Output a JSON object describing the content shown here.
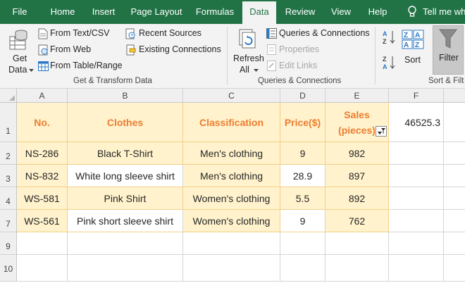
{
  "tabs": [
    {
      "label": "File",
      "active": false
    },
    {
      "label": "Home",
      "active": false
    },
    {
      "label": "Insert",
      "active": false
    },
    {
      "label": "Page Layout",
      "active": false
    },
    {
      "label": "Formulas",
      "active": false
    },
    {
      "label": "Data",
      "active": true
    },
    {
      "label": "Review",
      "active": false
    },
    {
      "label": "View",
      "active": false
    },
    {
      "label": "Help",
      "active": false
    }
  ],
  "tell_me": "Tell me wh",
  "ribbon": {
    "get_data": {
      "line1": "Get",
      "line2": "Data"
    },
    "from_text_csv": "From Text/CSV",
    "from_web": "From Web",
    "from_table_range": "From Table/Range",
    "recent_sources": "Recent Sources",
    "existing_connections": "Existing Connections",
    "group_get_transform": "Get & Transform Data",
    "refresh_all": {
      "line1": "Refresh",
      "line2": "All"
    },
    "queries_connections": "Queries & Connections",
    "properties": "Properties",
    "edit_links": "Edit Links",
    "group_queries": "Queries & Connections",
    "sort": "Sort",
    "filter": "Filter",
    "group_sort": "Sort & Filt"
  },
  "sheet": {
    "columns": [
      "A",
      "B",
      "C",
      "D",
      "E",
      "F"
    ],
    "row_numbers": [
      "1",
      "2",
      "3",
      "4",
      "7",
      "9",
      "10"
    ],
    "headers": {
      "no": "No.",
      "clothes": "Clothes",
      "classification": "Classification",
      "price": "Price($)",
      "sales_line1": "Sales",
      "sales_line2": "(pieces)"
    },
    "f1_value": "46525.3",
    "rows": [
      {
        "no": "NS-286",
        "clothes": "Black T-Shirt",
        "classification": "Men's clothing",
        "price": "9",
        "sales": "982"
      },
      {
        "no": "NS-832",
        "clothes": "White long sleeve shirt",
        "classification": "Men's clothing",
        "price": "28.9",
        "sales": "897"
      },
      {
        "no": "WS-581",
        "clothes": "Pink Shirt",
        "classification": "Women's clothing",
        "price": "5.5",
        "sales": "892"
      },
      {
        "no": "WS-561",
        "clothes": "Pink short sleeve shirt",
        "classification": "Women's clothing",
        "price": "9",
        "sales": "762"
      }
    ]
  },
  "colors": {
    "excel_green": "#217346",
    "header_orange": "#ed7d31",
    "cell_yellow": "#fff2cc"
  }
}
